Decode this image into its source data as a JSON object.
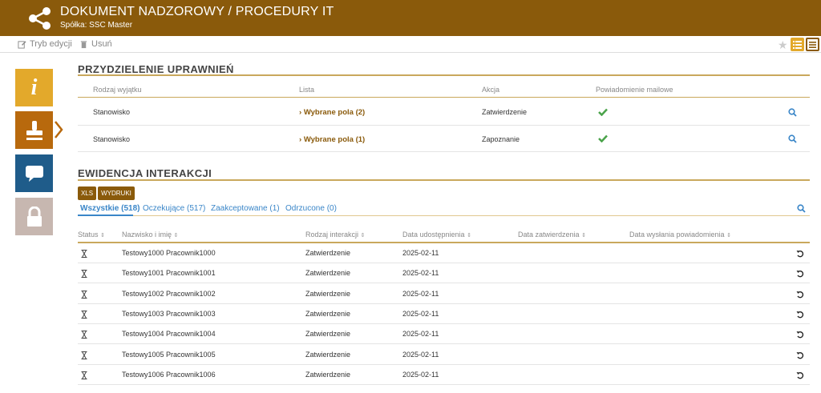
{
  "header": {
    "title": "DOKUMENT NADZOROWY / PROCEDURY IT",
    "subtitle": "Spółka: SSC Master"
  },
  "toolbar": {
    "edit_label": "Tryb edycji",
    "delete_label": "Usuń"
  },
  "permissions": {
    "title": "PRZYDZIELENIE UPRAWNIEŃ",
    "columns": [
      "Rodzaj wyjątku",
      "Lista",
      "Akcja",
      "Powiadomienie mailowe"
    ],
    "rows": [
      {
        "type": "Stanowisko",
        "list": "Wybrane pola (2)",
        "action": "Zatwierdzenie"
      },
      {
        "type": "Stanowisko",
        "list": "Wybrane pola (1)",
        "action": "Zapoznanie"
      }
    ]
  },
  "interactions": {
    "title": "EWIDENCJA INTERAKCJI",
    "buttons": {
      "xls": "XLS",
      "print": "WYDRUKI"
    },
    "tabs": [
      "Wszystkie (518)",
      "Oczekujące (517)",
      "Zaakceptowane (1)",
      "Odrzucone (0)"
    ],
    "columns": [
      "Status",
      "Nazwisko i imię",
      "Rodzaj interakcji",
      "Data udostępnienia",
      "Data zatwierdzenia",
      "Data wysłania powiadomienia"
    ],
    "rows": [
      {
        "name": "Testowy1000 Pracownik1000",
        "type": "Zatwierdzenie",
        "shared": "2025-02-11"
      },
      {
        "name": "Testowy1001 Pracownik1001",
        "type": "Zatwierdzenie",
        "shared": "2025-02-11"
      },
      {
        "name": "Testowy1002 Pracownik1002",
        "type": "Zatwierdzenie",
        "shared": "2025-02-11"
      },
      {
        "name": "Testowy1003 Pracownik1003",
        "type": "Zatwierdzenie",
        "shared": "2025-02-11"
      },
      {
        "name": "Testowy1004 Pracownik1004",
        "type": "Zatwierdzenie",
        "shared": "2025-02-11"
      },
      {
        "name": "Testowy1005 Pracownik1005",
        "type": "Zatwierdzenie",
        "shared": "2025-02-11"
      },
      {
        "name": "Testowy1006 Pracownik1006",
        "type": "Zatwierdzenie",
        "shared": "2025-02-11"
      }
    ]
  },
  "sidebar": {
    "tiles": [
      "info-icon",
      "stamp-icon",
      "chat-icon",
      "lock-icon"
    ]
  },
  "colors": {
    "brand": "#8a5a0b",
    "accent": "#c9a85c",
    "info_tile": "#e3a92b",
    "stamp_tile": "#b8690d",
    "chat_tile": "#1f5c8a",
    "lock_tile": "#c7b7b0",
    "link": "#3a86c8",
    "check": "#4aa34a"
  }
}
